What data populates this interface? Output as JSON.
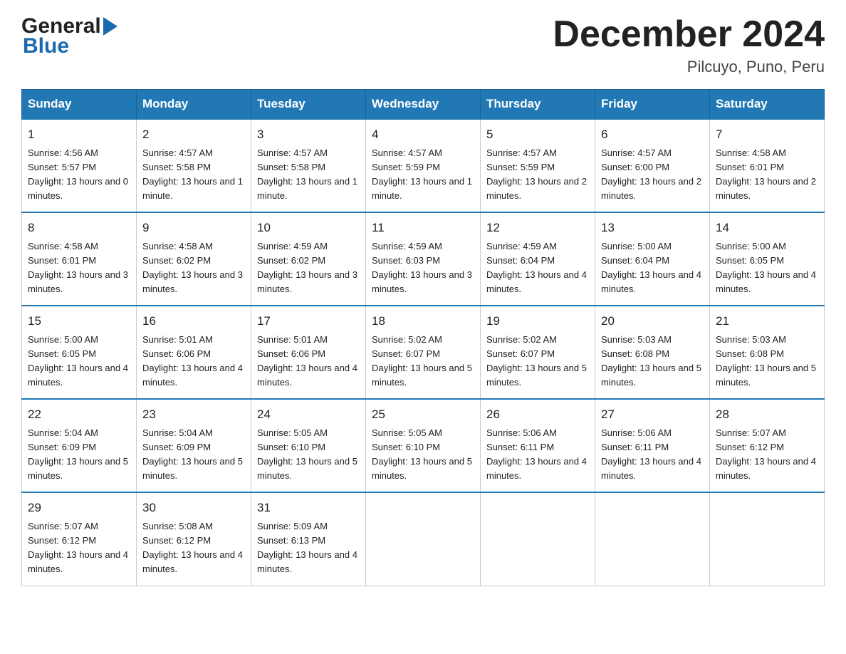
{
  "header": {
    "logo_general": "General",
    "logo_blue": "Blue",
    "title": "December 2024",
    "subtitle": "Pilcuyo, Puno, Peru"
  },
  "days_of_week": [
    "Sunday",
    "Monday",
    "Tuesday",
    "Wednesday",
    "Thursday",
    "Friday",
    "Saturday"
  ],
  "weeks": [
    [
      {
        "day": "1",
        "sunrise": "4:56 AM",
        "sunset": "5:57 PM",
        "daylight": "13 hours and 0 minutes."
      },
      {
        "day": "2",
        "sunrise": "4:57 AM",
        "sunset": "5:58 PM",
        "daylight": "13 hours and 1 minute."
      },
      {
        "day": "3",
        "sunrise": "4:57 AM",
        "sunset": "5:58 PM",
        "daylight": "13 hours and 1 minute."
      },
      {
        "day": "4",
        "sunrise": "4:57 AM",
        "sunset": "5:59 PM",
        "daylight": "13 hours and 1 minute."
      },
      {
        "day": "5",
        "sunrise": "4:57 AM",
        "sunset": "5:59 PM",
        "daylight": "13 hours and 2 minutes."
      },
      {
        "day": "6",
        "sunrise": "4:57 AM",
        "sunset": "6:00 PM",
        "daylight": "13 hours and 2 minutes."
      },
      {
        "day": "7",
        "sunrise": "4:58 AM",
        "sunset": "6:01 PM",
        "daylight": "13 hours and 2 minutes."
      }
    ],
    [
      {
        "day": "8",
        "sunrise": "4:58 AM",
        "sunset": "6:01 PM",
        "daylight": "13 hours and 3 minutes."
      },
      {
        "day": "9",
        "sunrise": "4:58 AM",
        "sunset": "6:02 PM",
        "daylight": "13 hours and 3 minutes."
      },
      {
        "day": "10",
        "sunrise": "4:59 AM",
        "sunset": "6:02 PM",
        "daylight": "13 hours and 3 minutes."
      },
      {
        "day": "11",
        "sunrise": "4:59 AM",
        "sunset": "6:03 PM",
        "daylight": "13 hours and 3 minutes."
      },
      {
        "day": "12",
        "sunrise": "4:59 AM",
        "sunset": "6:04 PM",
        "daylight": "13 hours and 4 minutes."
      },
      {
        "day": "13",
        "sunrise": "5:00 AM",
        "sunset": "6:04 PM",
        "daylight": "13 hours and 4 minutes."
      },
      {
        "day": "14",
        "sunrise": "5:00 AM",
        "sunset": "6:05 PM",
        "daylight": "13 hours and 4 minutes."
      }
    ],
    [
      {
        "day": "15",
        "sunrise": "5:00 AM",
        "sunset": "6:05 PM",
        "daylight": "13 hours and 4 minutes."
      },
      {
        "day": "16",
        "sunrise": "5:01 AM",
        "sunset": "6:06 PM",
        "daylight": "13 hours and 4 minutes."
      },
      {
        "day": "17",
        "sunrise": "5:01 AM",
        "sunset": "6:06 PM",
        "daylight": "13 hours and 4 minutes."
      },
      {
        "day": "18",
        "sunrise": "5:02 AM",
        "sunset": "6:07 PM",
        "daylight": "13 hours and 5 minutes."
      },
      {
        "day": "19",
        "sunrise": "5:02 AM",
        "sunset": "6:07 PM",
        "daylight": "13 hours and 5 minutes."
      },
      {
        "day": "20",
        "sunrise": "5:03 AM",
        "sunset": "6:08 PM",
        "daylight": "13 hours and 5 minutes."
      },
      {
        "day": "21",
        "sunrise": "5:03 AM",
        "sunset": "6:08 PM",
        "daylight": "13 hours and 5 minutes."
      }
    ],
    [
      {
        "day": "22",
        "sunrise": "5:04 AM",
        "sunset": "6:09 PM",
        "daylight": "13 hours and 5 minutes."
      },
      {
        "day": "23",
        "sunrise": "5:04 AM",
        "sunset": "6:09 PM",
        "daylight": "13 hours and 5 minutes."
      },
      {
        "day": "24",
        "sunrise": "5:05 AM",
        "sunset": "6:10 PM",
        "daylight": "13 hours and 5 minutes."
      },
      {
        "day": "25",
        "sunrise": "5:05 AM",
        "sunset": "6:10 PM",
        "daylight": "13 hours and 5 minutes."
      },
      {
        "day": "26",
        "sunrise": "5:06 AM",
        "sunset": "6:11 PM",
        "daylight": "13 hours and 4 minutes."
      },
      {
        "day": "27",
        "sunrise": "5:06 AM",
        "sunset": "6:11 PM",
        "daylight": "13 hours and 4 minutes."
      },
      {
        "day": "28",
        "sunrise": "5:07 AM",
        "sunset": "6:12 PM",
        "daylight": "13 hours and 4 minutes."
      }
    ],
    [
      {
        "day": "29",
        "sunrise": "5:07 AM",
        "sunset": "6:12 PM",
        "daylight": "13 hours and 4 minutes."
      },
      {
        "day": "30",
        "sunrise": "5:08 AM",
        "sunset": "6:12 PM",
        "daylight": "13 hours and 4 minutes."
      },
      {
        "day": "31",
        "sunrise": "5:09 AM",
        "sunset": "6:13 PM",
        "daylight": "13 hours and 4 minutes."
      },
      null,
      null,
      null,
      null
    ]
  ]
}
